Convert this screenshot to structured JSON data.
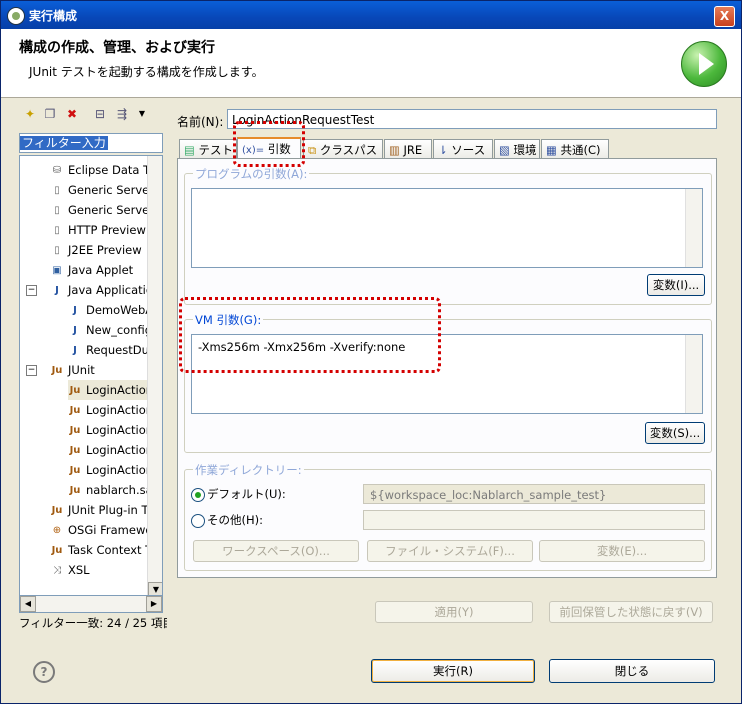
{
  "window": {
    "title": "実行構成",
    "close_label": "X"
  },
  "banner": {
    "heading": "構成の作成、管理、および実行",
    "description": "JUnit テストを起動する構成を作成します。"
  },
  "left_pane": {
    "filter_text": "フィルター入力",
    "tree_items": [
      {
        "label": "Eclipse Data Tool",
        "icon": "database-icon"
      },
      {
        "label": "Generic Server",
        "icon": "server-icon"
      },
      {
        "label": "Generic Server(E",
        "icon": "server-icon"
      },
      {
        "label": "HTTP Preview",
        "icon": "server-icon"
      },
      {
        "label": "J2EE Preview",
        "icon": "server-icon"
      },
      {
        "label": "Java Applet",
        "icon": "applet-icon"
      },
      {
        "label": "Java Application",
        "icon": "java-app-icon"
      },
      {
        "label": "DemoWebApp",
        "icon": "java-config-icon"
      },
      {
        "label": "New_configu",
        "icon": "java-config-icon"
      },
      {
        "label": "RequestDump",
        "icon": "java-config-icon"
      },
      {
        "label": "JUnit",
        "icon": "junit-icon"
      },
      {
        "label": "LoginActionRe",
        "icon": "junit-config-icon"
      },
      {
        "label": "LoginActionRe",
        "icon": "junit-config-icon"
      },
      {
        "label": "LoginActionRe",
        "icon": "junit-config-icon"
      },
      {
        "label": "LoginActionRe",
        "icon": "junit-config-icon"
      },
      {
        "label": "LoginActionRe",
        "icon": "junit-config-icon"
      },
      {
        "label": "nablarch.sam",
        "icon": "junit-config-icon"
      },
      {
        "label": "JUnit Plug-in Tes",
        "icon": "junit-plugin-icon"
      },
      {
        "label": "OSGi Framework",
        "icon": "osgi-icon"
      },
      {
        "label": "Task Context Tes",
        "icon": "task-context-icon"
      },
      {
        "label": "XSL",
        "icon": "xsl-icon"
      }
    ],
    "filter_count": "フィルター一致: 24 / 25 項目"
  },
  "config": {
    "name_label": "名前(N):",
    "name_value": "LoginActionRequestTest",
    "tabs": [
      {
        "label": "テスト",
        "icon": "test-tab-icon"
      },
      {
        "label": "引数",
        "icon": "arguments-tab-icon"
      },
      {
        "label": "クラスパス",
        "icon": "classpath-tab-icon"
      },
      {
        "label": "JRE",
        "icon": "jre-tab-icon"
      },
      {
        "label": "ソース",
        "icon": "source-tab-icon"
      },
      {
        "label": "環境",
        "icon": "environment-tab-icon"
      },
      {
        "label": "共通(C)",
        "icon": "common-tab-icon"
      }
    ],
    "active_tab": "引数",
    "program_args": {
      "title": "プログラムの引数(A):",
      "value": "",
      "variables_button": "変数(I)..."
    },
    "vm_args": {
      "title": "VM 引数(G):",
      "value": "-Xms256m -Xmx256m -Xverify:none",
      "variables_button": "変数(S)..."
    },
    "working_dir": {
      "title": "作業ディレクトリー:",
      "default_label": "デフォルト(U):",
      "default_value": "${workspace_loc:Nablarch_sample_test}",
      "other_label": "その他(H):",
      "other_value": "",
      "workspace_button": "ワークスペース(O)...",
      "filesystem_button": "ファイル・システム(F)...",
      "variables_button": "変数(E)..."
    },
    "apply_button": "適用(Y)",
    "revert_button": "前回保管した状態に戻す(V)"
  },
  "footer": {
    "help": "?",
    "run_button": "実行(R)",
    "close_button": "閉じる"
  },
  "colors": {
    "title_bar": "#0847b8",
    "highlight_box": "#d40000",
    "group_title": "#0046d5"
  }
}
